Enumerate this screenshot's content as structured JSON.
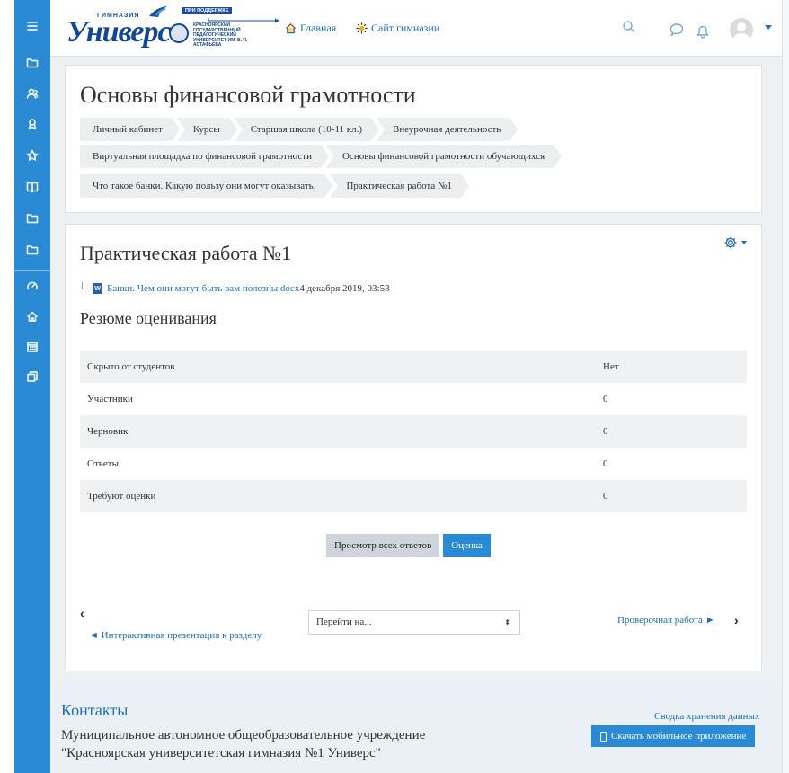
{
  "navbar": {
    "logo": {
      "school_small": "ГИМНАЗИЯ",
      "name": "Универс",
      "support_label": "ПРИ ПОДДЕРЖКЕ",
      "university": "КРАСНОЯРСКИЙ ГОСУДАРСТВЕННЫЙ ПЕДАГОГИЧЕСКИЙ УНИВЕРСИТЕТ ИМ. В. П. АСТАФЬЕВА"
    },
    "links": [
      {
        "label": "Главная",
        "icon": "home-icon"
      },
      {
        "label": "Сайт гимназии",
        "icon": "sun-icon"
      }
    ]
  },
  "sidebar": {
    "items": [
      "menu-icon",
      "folder-icon",
      "users-icon",
      "user-group-icon",
      "star-icon",
      "book-icon",
      "folder-icon",
      "folder-icon",
      "dashboard-icon",
      "home-icon",
      "calendar-icon",
      "copy-icon"
    ]
  },
  "header": {
    "title": "Основы финансовой грамотности",
    "breadcrumb_rows": [
      [
        "Личный кабинет",
        "Курсы",
        "Старшая школа (10-11 кл.)",
        "Внеурочная деятельность"
      ],
      [
        "Виртуальная площадка по финансовой грамотности",
        "Основы финансовой грамотности обучающихся"
      ],
      [
        "Что такое банки. Какую пользу они могут оказывать.",
        "Практическая работа №1"
      ]
    ]
  },
  "main": {
    "title": "Практическая работа №1",
    "file": {
      "icon_text": "W",
      "name": "Банки. Чем они могут быть вам полезны.docx",
      "date": "4 декабря 2019, 03:53"
    },
    "summary_title": "Резюме оценивания",
    "table": [
      {
        "label": "Скрыто от студентов",
        "value": "Нет"
      },
      {
        "label": "Участники",
        "value": "0"
      },
      {
        "label": "Черновик",
        "value": "0"
      },
      {
        "label": "Ответы",
        "value": "0"
      },
      {
        "label": "Требуют оценки",
        "value": "0"
      }
    ],
    "buttons": {
      "view_all": "Просмотр всех ответов",
      "grade": "Оценка"
    },
    "nav": {
      "prev_chevron": "‹",
      "prev_label": "◄ Интерактивная презентация к разделу",
      "jump_label": "Перейти на...",
      "jump_arrow": "⬍",
      "next_label": "Проверочная работа ►",
      "next_chevron": "›"
    }
  },
  "footer": {
    "title": "Контакты",
    "text": "Муниципальное автономное общеобразовательное учреждение \"Красноярская университетская гимназия №1 Универс\"",
    "data_link": "Сводка хранения данных",
    "app_button": "Скачать мобильное приложение"
  },
  "colors": {
    "accent": "#2a8bd4",
    "link": "#1f6fb4",
    "brand_dark": "#16468f"
  }
}
